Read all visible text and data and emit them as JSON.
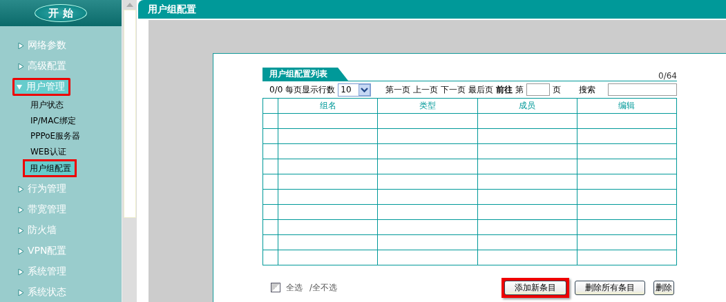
{
  "sidebar": {
    "start_button": "开 始",
    "items": [
      {
        "label": "网络参数",
        "expanded": false,
        "selected": false
      },
      {
        "label": "高级配置",
        "expanded": false,
        "selected": false
      },
      {
        "label": "用户管理",
        "expanded": true,
        "selected": true,
        "children": [
          {
            "label": "用户状态",
            "selected": false
          },
          {
            "label": "IP/MAC绑定",
            "selected": false
          },
          {
            "label": "PPPoE服务器",
            "selected": false
          },
          {
            "label": "WEB认证",
            "selected": false
          },
          {
            "label": "用户组配置",
            "selected": true
          }
        ]
      },
      {
        "label": "行为管理",
        "expanded": false,
        "selected": false
      },
      {
        "label": "带宽管理",
        "expanded": false,
        "selected": false
      },
      {
        "label": "防火墙",
        "expanded": false,
        "selected": false
      },
      {
        "label": "VPN配置",
        "expanded": false,
        "selected": false
      },
      {
        "label": "系统管理",
        "expanded": false,
        "selected": false
      },
      {
        "label": "系统状态",
        "expanded": false,
        "selected": false
      }
    ]
  },
  "header": {
    "title": "用户组配置"
  },
  "list": {
    "title": "用户组配置列表",
    "capacity": "0/64",
    "count": "0/0",
    "rows_per_page_label": "每页显示行数",
    "rows_per_page": "10",
    "pager": [
      "第一页",
      "上一页",
      "下一页",
      "最后页",
      "前往"
    ],
    "page_prefix": "第",
    "page_suffix": "页",
    "search_label": "搜索",
    "columns": [
      "组名",
      "类型",
      "成员",
      "编辑"
    ],
    "rows": [
      {
        "selected": false
      },
      {
        "selected": false
      },
      {
        "selected": false
      },
      {
        "selected": false
      },
      {
        "selected": false
      },
      {
        "selected": false
      },
      {
        "selected": false
      },
      {
        "selected": false
      },
      {
        "selected": false
      },
      {
        "selected": false
      }
    ],
    "select_all_checked": false,
    "select_all": "全选",
    "select_none": "/全不选",
    "buttons": [
      {
        "label": "添加新条目",
        "highlighted": true
      },
      {
        "label": "删除所有条目",
        "highlighted": false
      },
      {
        "label": "删除",
        "highlighted": false
      }
    ]
  }
}
